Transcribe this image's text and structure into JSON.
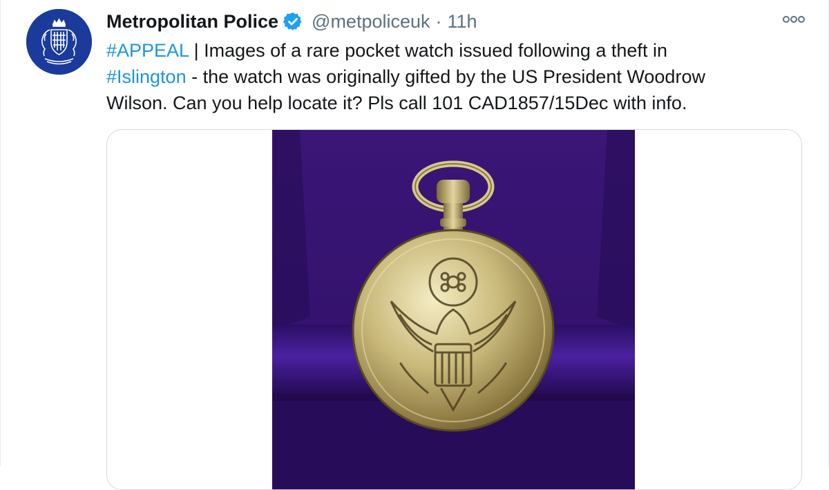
{
  "tweet": {
    "author_name": "Metropolitan Police",
    "handle": "@metpoliceuk",
    "separator": "·",
    "time": "11h",
    "text_lines": [
      [
        {
          "t": "#APPEAL",
          "tag": true
        },
        {
          "t": " | Images of a rare pocket watch issued following a theft in",
          "tag": false
        }
      ],
      [
        {
          "t": "#Islington",
          "tag": true
        },
        {
          "t": " - the watch was originally gifted by the US President Woodrow",
          "tag": false
        }
      ],
      [
        {
          "t": "Wilson. Can you help locate it? Pls call 101 CAD1857/15Dec with info.",
          "tag": false
        }
      ]
    ]
  },
  "icons": {
    "avatar": "police-crest-icon",
    "verified": "verified-badge-icon",
    "more": "more-options-icon"
  },
  "colors": {
    "link": "#1b95e0",
    "text": "#14171a",
    "secondary": "#5b7083",
    "avatar_bg": "#1a3b9c",
    "verified": "#1da1f2",
    "velvet": "#3b1580"
  }
}
